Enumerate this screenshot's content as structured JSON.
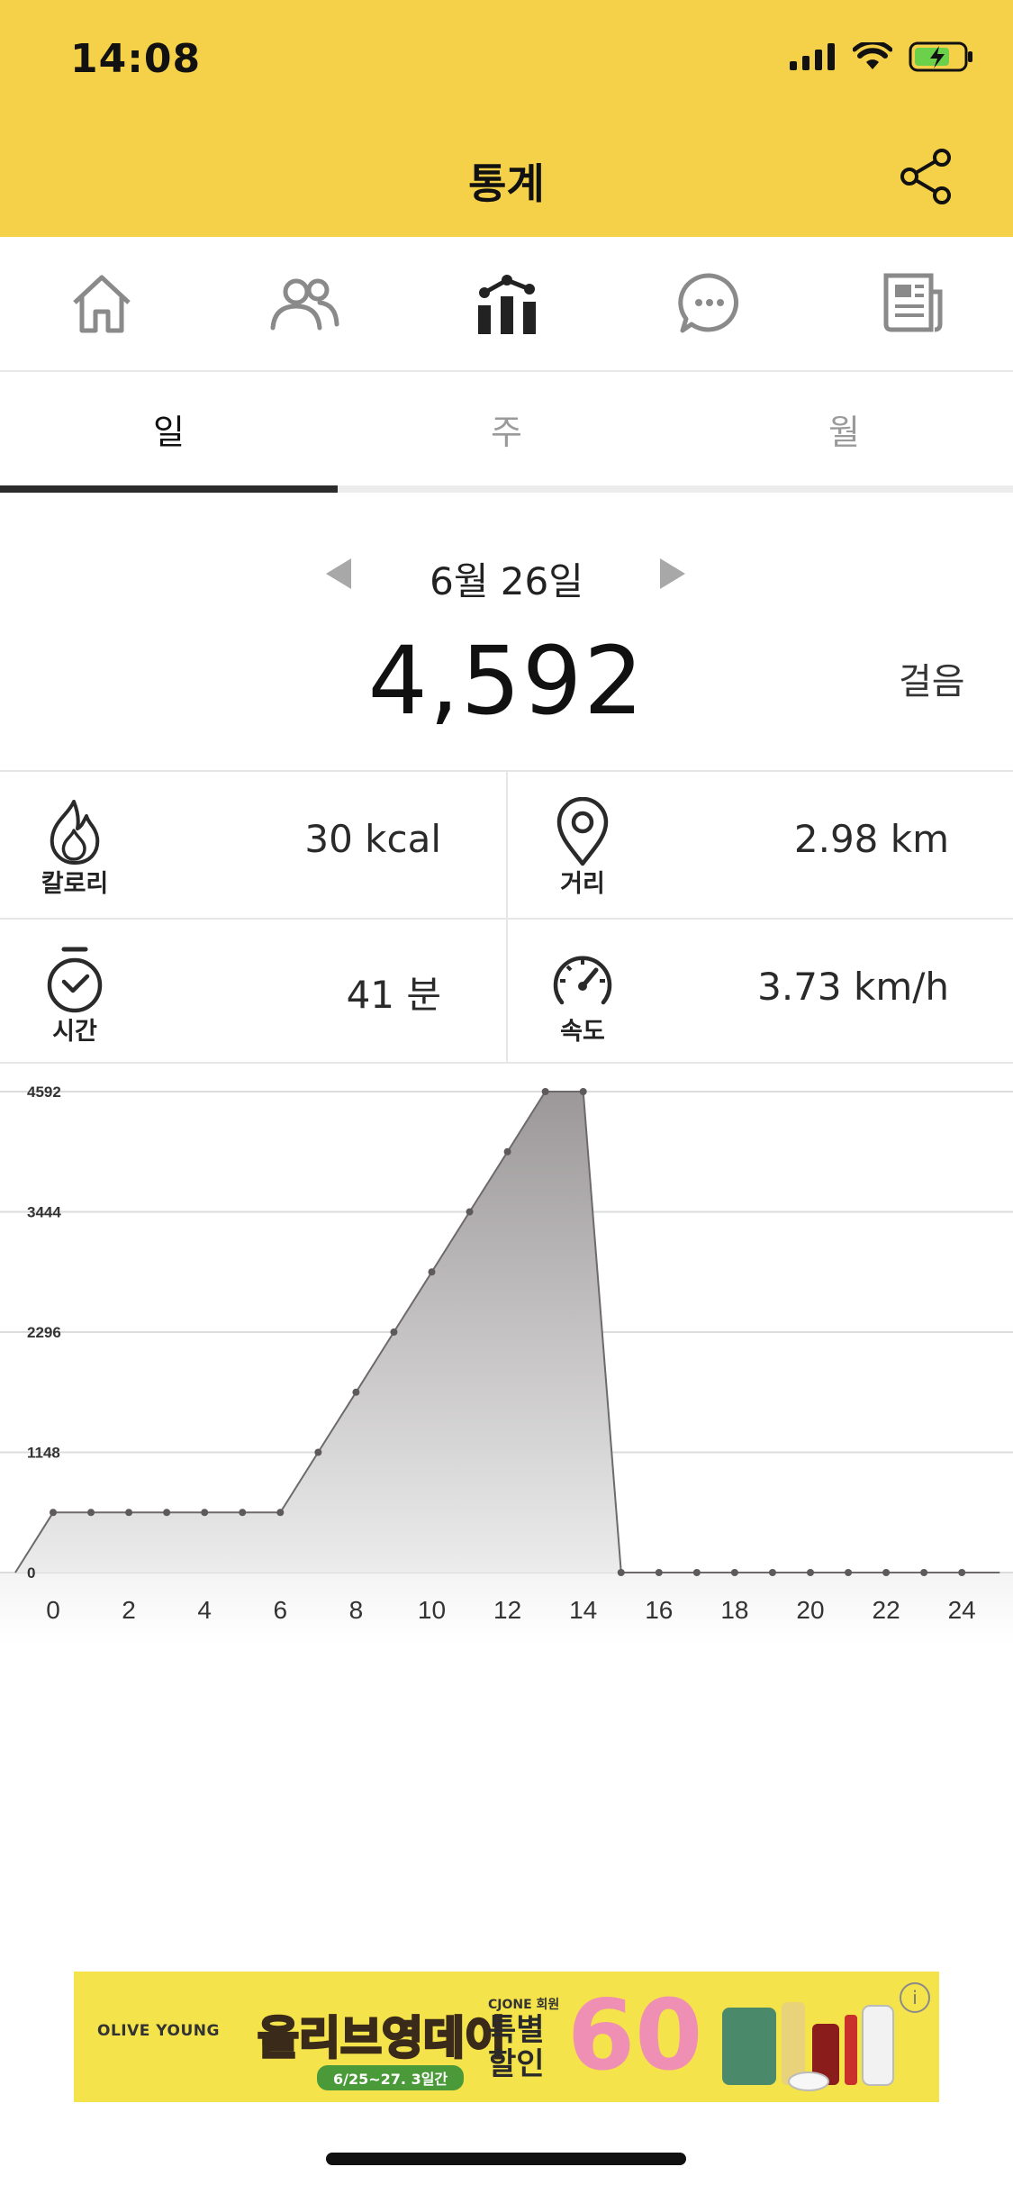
{
  "status_bar": {
    "time": "14:08"
  },
  "header": {
    "title": "통계"
  },
  "nav": {
    "items": [
      {
        "name": "home",
        "icon": "home-icon"
      },
      {
        "name": "friends",
        "icon": "people-icon"
      },
      {
        "name": "stats",
        "icon": "bar-chart-icon",
        "active": true
      },
      {
        "name": "chat",
        "icon": "chat-bubble-icon"
      },
      {
        "name": "news",
        "icon": "newspaper-icon"
      }
    ]
  },
  "tabs": [
    {
      "label": "일",
      "active": true
    },
    {
      "label": "주",
      "active": false
    },
    {
      "label": "월",
      "active": false
    }
  ],
  "date": {
    "label": "6월 26일"
  },
  "steps": {
    "count": "4,592",
    "unit": "걸음"
  },
  "stats": {
    "calories": {
      "label": "칼로리",
      "value": "30 kcal",
      "icon": "flame-icon"
    },
    "distance": {
      "label": "거리",
      "value": "2.98 km",
      "icon": "location-pin-icon"
    },
    "time": {
      "label": "시간",
      "value": "41 분",
      "icon": "stopwatch-icon"
    },
    "speed": {
      "label": "속도",
      "value": "3.73 km/h",
      "icon": "speedometer-icon"
    }
  },
  "chart_data": {
    "type": "area",
    "x": [
      -1,
      0,
      1,
      2,
      3,
      4,
      5,
      6,
      7,
      8,
      9,
      10,
      11,
      12,
      13,
      14,
      15,
      16,
      17,
      18,
      19,
      20,
      21,
      22,
      23,
      24,
      25
    ],
    "values": [
      0,
      574,
      574,
      574,
      574,
      574,
      574,
      574,
      1148,
      1722,
      2296,
      2870,
      3444,
      4018,
      4592,
      4592,
      0,
      0,
      0,
      0,
      0,
      0,
      0,
      0,
      0,
      0,
      0
    ],
    "x_ticks": [
      "0",
      "2",
      "4",
      "6",
      "8",
      "10",
      "12",
      "14",
      "16",
      "18",
      "20",
      "22",
      "24"
    ],
    "x_tick_values": [
      0,
      2,
      4,
      6,
      8,
      10,
      12,
      14,
      16,
      18,
      20,
      22,
      24
    ],
    "y_ticks": [
      "0",
      "1148",
      "2296",
      "3444",
      "4592"
    ],
    "y_tick_values": [
      0,
      1148,
      2296,
      3444,
      4592
    ],
    "ylim": [
      0,
      4592
    ],
    "grid": true
  },
  "ad": {
    "brand": "OLIVE YOUNG",
    "title_main": "올리브영",
    "title_highlight": "데이",
    "dates": "6/25~27. 3일간",
    "cj": "CJONE 회원",
    "sale": "특별 할인",
    "percent": "60",
    "info": "i"
  }
}
